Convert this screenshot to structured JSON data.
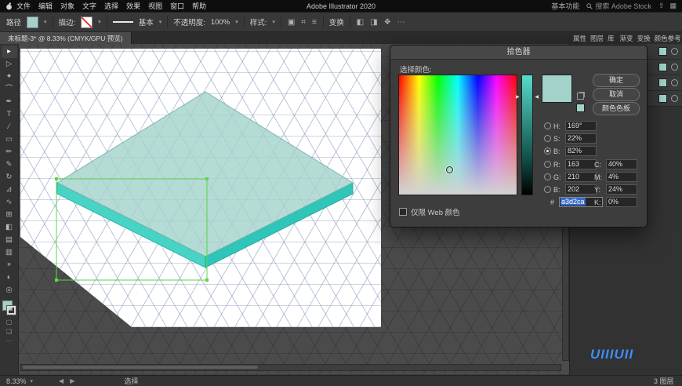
{
  "menubar": {
    "items": [
      "文件",
      "编辑",
      "对象",
      "文字",
      "选择",
      "效果",
      "视图",
      "窗口",
      "帮助"
    ],
    "app_title": "Adobe Illustrator 2020",
    "workspace": "基本功能",
    "search_placeholder": "搜索 Adobe Stock",
    "right_icons": [
      {
        "name": "share-icon",
        "glyph": "⇧"
      },
      {
        "name": "apps-icon",
        "glyph": "▦"
      }
    ]
  },
  "controlbar": {
    "object_label": "路径",
    "stroke_label": "描边:",
    "brush_name": "基本",
    "opacity_label": "不透明度:",
    "opacity_value": "100%",
    "style_label": "样式:",
    "transform_label": "变换",
    "icons_group1": [
      {
        "name": "document-setup-icon",
        "glyph": "▣"
      },
      {
        "name": "preferences-icon",
        "glyph": "⌗"
      },
      {
        "name": "options-menu-icon",
        "glyph": "≡"
      }
    ],
    "icons_group2": [
      {
        "name": "align-horizontal-icon",
        "glyph": "◧"
      },
      {
        "name": "align-vertical-icon",
        "glyph": "◨"
      },
      {
        "name": "arrange-icon",
        "glyph": "❖"
      },
      {
        "name": "more-options-icon",
        "glyph": "⋯"
      }
    ]
  },
  "document_tab": {
    "title": "未标题-3* @ 8.33% (CMYK/GPU 预览)"
  },
  "tools": [
    {
      "name": "selection-tool",
      "glyph": "▸"
    },
    {
      "name": "direct-selection-tool",
      "glyph": "▷"
    },
    {
      "name": "magic-wand-tool",
      "glyph": "✦"
    },
    {
      "name": "lasso-tool",
      "glyph": "⌒"
    },
    {
      "name": "pen-tool",
      "glyph": "✒"
    },
    {
      "name": "type-tool",
      "glyph": "T"
    },
    {
      "name": "line-segment-tool",
      "glyph": "∕"
    },
    {
      "name": "rectangle-tool",
      "glyph": "▭"
    },
    {
      "name": "paintbrush-tool",
      "glyph": "✏"
    },
    {
      "name": "pencil-tool",
      "glyph": "✎"
    },
    {
      "name": "rotate-tool",
      "glyph": "↻"
    },
    {
      "name": "scale-tool",
      "glyph": "⊿"
    },
    {
      "name": "width-tool",
      "glyph": "∿"
    },
    {
      "name": "free-transform-tool",
      "glyph": "⊞"
    },
    {
      "name": "shape-builder-tool",
      "glyph": "◧"
    },
    {
      "name": "mesh-tool",
      "glyph": "▤"
    },
    {
      "name": "gradient-tool",
      "glyph": "▥"
    },
    {
      "name": "eyedropper-tool",
      "glyph": "⌖"
    },
    {
      "name": "blend-tool",
      "glyph": "◐"
    },
    {
      "name": "zoom-tool",
      "glyph": "◎"
    }
  ],
  "panels": {
    "tabs_group1": [
      "属性",
      "图层",
      "库"
    ],
    "tabs_group2": [
      "渐变",
      "变换",
      "颜色参考"
    ]
  },
  "layers": {
    "rows": [
      {
        "swatch": "#9fd4cb"
      },
      {
        "swatch": "#9fd4cb"
      },
      {
        "swatch": "#9fd4cb"
      },
      {
        "swatch": "#9fd4cb"
      }
    ],
    "count_label": "3 图层"
  },
  "dialog": {
    "title": "拾色器",
    "select_label": "选择颜色:",
    "buttons": {
      "ok": "确定",
      "cancel": "取消",
      "swatches": "颜色色板"
    },
    "fields": {
      "h": {
        "label": "H:",
        "value": "169°"
      },
      "s": {
        "label": "S:",
        "value": "22%"
      },
      "b": {
        "label": "B:",
        "value": "82%"
      },
      "r": {
        "label": "R:",
        "value": "163"
      },
      "g": {
        "label": "G:",
        "value": "210"
      },
      "b2": {
        "label": "B:",
        "value": "202"
      },
      "c": {
        "label": "C:",
        "value": "40%"
      },
      "m": {
        "label": "M:",
        "value": "4%"
      },
      "y": {
        "label": "Y:",
        "value": "24%"
      },
      "k": {
        "label": "K:",
        "value": "0%"
      },
      "hex": {
        "label": "#",
        "value": "a3d2ca"
      }
    },
    "web_only_label": "仅限 Web 颜色",
    "current_color": "#a3d2ca"
  },
  "statusbar": {
    "zoom": "8.33%",
    "tool": "选择"
  },
  "watermark": {
    "text": "UIIIUII"
  },
  "icons": {
    "caret_down": "▾",
    "prev_arrow": "◀",
    "next_arrow": "▶"
  },
  "colors": {
    "fill_teal": "#a3d2ca",
    "side_left_teal": "#49d3c5",
    "side_right_teal": "#2fc5b8",
    "selection_green": "#5bd64b",
    "hex_selection_blue": "#3a6bc9",
    "watermark_blue": "#3d8df5"
  }
}
